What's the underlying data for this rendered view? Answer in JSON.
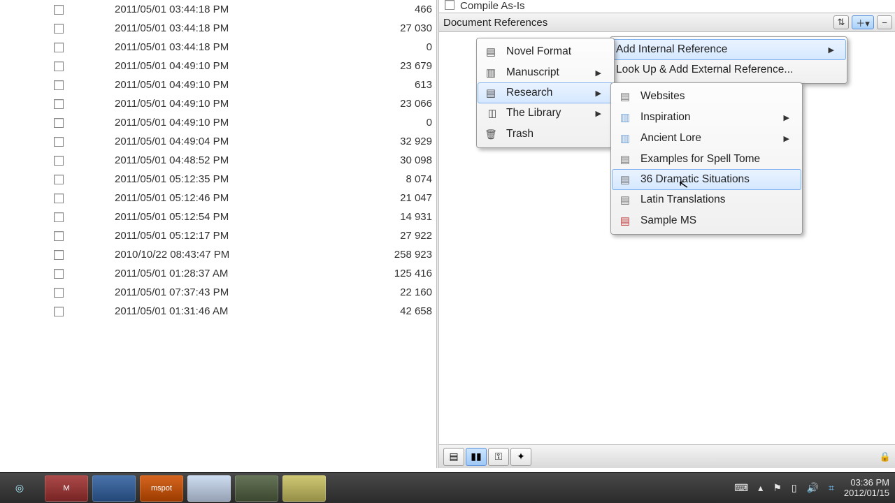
{
  "left": {
    "rows": [
      {
        "date": "2011/05/01 03:44:18 PM",
        "num": "466"
      },
      {
        "date": "2011/05/01 03:44:18 PM",
        "num": "27 030"
      },
      {
        "date": "2011/05/01 03:44:18 PM",
        "num": "0"
      },
      {
        "date": "2011/05/01 04:49:10 PM",
        "num": "23 679"
      },
      {
        "date": "2011/05/01 04:49:10 PM",
        "num": "613"
      },
      {
        "date": "2011/05/01 04:49:10 PM",
        "num": "23 066"
      },
      {
        "date": "2011/05/01 04:49:10 PM",
        "num": "0"
      },
      {
        "date": "2011/05/01 04:49:04 PM",
        "num": "32 929"
      },
      {
        "date": "2011/05/01 04:48:52 PM",
        "num": "30 098"
      },
      {
        "date": "2011/05/01 05:12:35 PM",
        "num": "8 074"
      },
      {
        "date": "2011/05/01 05:12:46 PM",
        "num": "21 047"
      },
      {
        "date": "2011/05/01 05:12:54 PM",
        "num": "14 931"
      },
      {
        "date": "2011/05/01 05:12:17 PM",
        "num": "27 922"
      },
      {
        "date": "2010/10/22 08:43:47 PM",
        "num": "258 923"
      },
      {
        "date": "2011/05/01 01:28:37 AM",
        "num": "125 416"
      },
      {
        "date": "2011/05/01 07:37:43 PM",
        "num": "22 160"
      },
      {
        "date": "2011/05/01 01:31:46 AM",
        "num": "42 658"
      }
    ]
  },
  "right": {
    "compile_label": "Compile As-Is",
    "docrefs_label": "Document References"
  },
  "menu1": {
    "items": [
      {
        "label": "Novel Format",
        "icon": "ic-doc",
        "arrow": false
      },
      {
        "label": "Manuscript",
        "icon": "ic-book",
        "arrow": true
      },
      {
        "label": "Research",
        "icon": "ic-doc",
        "arrow": true,
        "highlight": true
      },
      {
        "label": "The Library",
        "icon": "ic-books",
        "arrow": true
      },
      {
        "label": "Trash",
        "icon": "ic-trash",
        "arrow": false
      }
    ]
  },
  "menu2": {
    "items": [
      {
        "label": "Add Internal Reference",
        "arrow": true,
        "highlight": true
      },
      {
        "label": "Look Up & Add External Reference...",
        "arrow": false
      }
    ]
  },
  "menu3": {
    "items": [
      {
        "label": "Websites",
        "icon": "ic-doc2",
        "arrow": false
      },
      {
        "label": "Inspiration",
        "icon": "ic-folder",
        "arrow": true
      },
      {
        "label": "Ancient Lore",
        "icon": "ic-folder",
        "arrow": true
      },
      {
        "label": "Examples for Spell Tome",
        "icon": "ic-doc2",
        "arrow": false
      },
      {
        "label": "36 Dramatic Situations",
        "icon": "ic-doc2",
        "arrow": false,
        "highlight": true
      },
      {
        "label": "Latin Translations",
        "icon": "ic-doc2",
        "arrow": false
      },
      {
        "label": "Sample MS",
        "icon": "ic-ms",
        "arrow": false
      }
    ]
  },
  "taskbar": {
    "apps": [
      "M",
      "",
      "mspot",
      "",
      "",
      ""
    ],
    "time": "03:36 PM",
    "date": "2012/01/15"
  }
}
